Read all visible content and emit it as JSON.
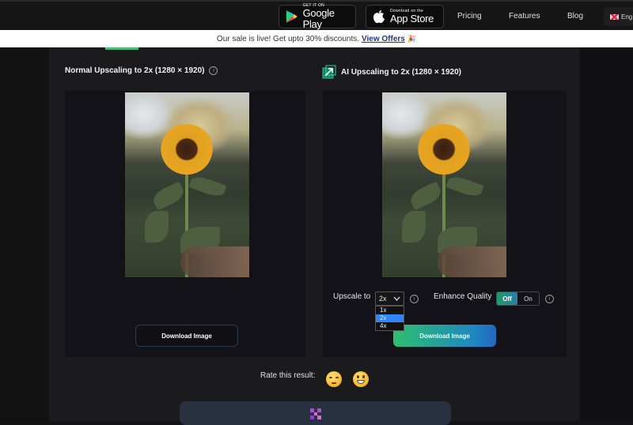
{
  "header": {
    "google_play": {
      "small": "GET IT ON",
      "big": "Google Play"
    },
    "app_store": {
      "small": "Download on the",
      "big": "App Store"
    },
    "nav": [
      "Pricing",
      "Features",
      "Blog"
    ],
    "language": "Eng"
  },
  "banner": {
    "text": "Our sale is live! Get upto 30% discounts.",
    "link": "View Offers",
    "emoji": "🎉"
  },
  "normal_panel": {
    "title": "Normal Upscaling to 2x (1280 × 1920)",
    "info": "i",
    "download_label": "Download Image"
  },
  "ai_panel": {
    "title": "AI Upscaling to 2x (1280 × 1920)",
    "upscale_label": "Upscale to",
    "upscale_value": "2x",
    "upscale_options": [
      "1x",
      "2x",
      "4x"
    ],
    "enhance_label": "Enhance Quality",
    "toggle_off": "Off",
    "toggle_on": "On",
    "info": "i",
    "download_label": "Download Image"
  },
  "rating": {
    "label": "Rate this result:"
  },
  "colors": {
    "accent_green": "#3fbf7a",
    "accent_blue": "#2f86f6"
  }
}
